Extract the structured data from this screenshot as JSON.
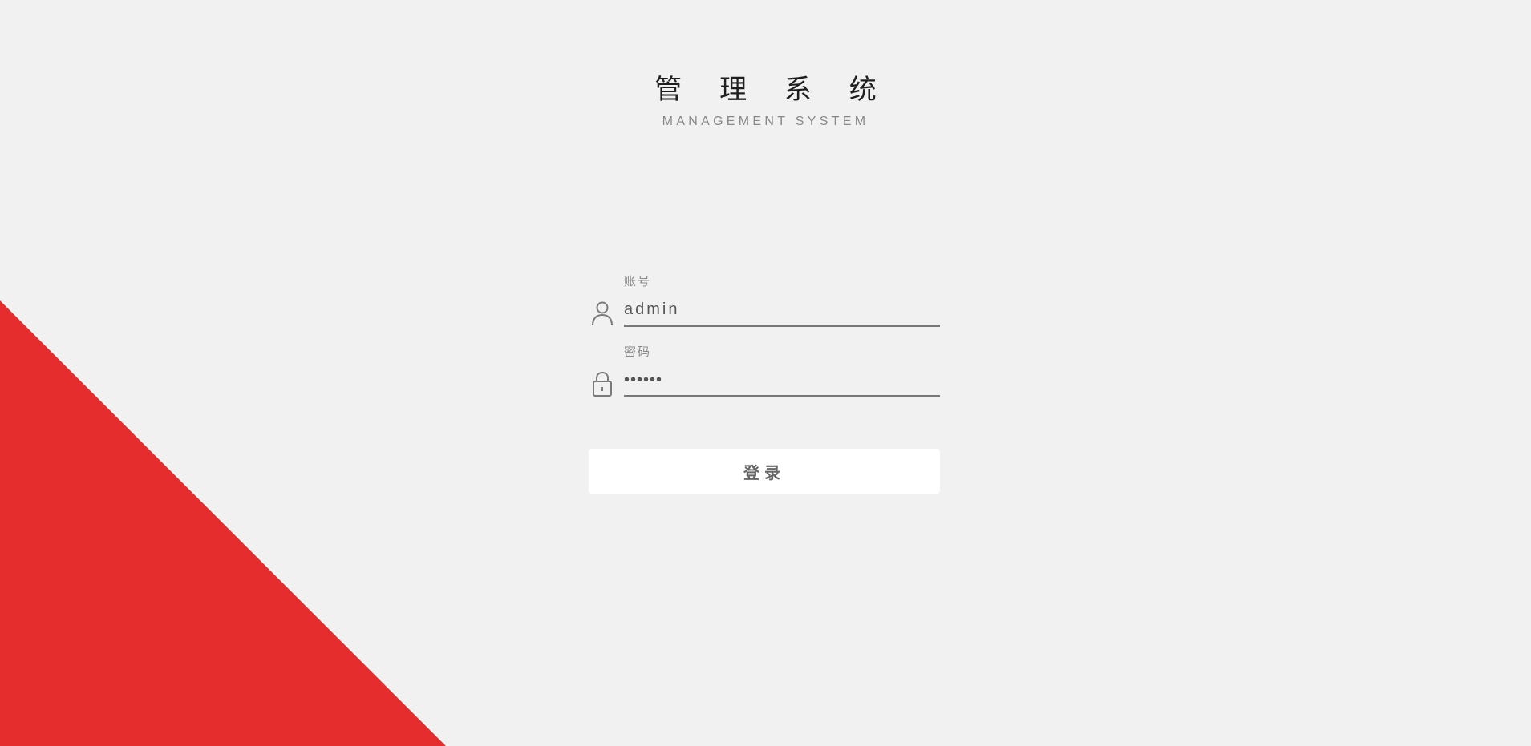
{
  "header": {
    "title_cn": "管 理 系 统",
    "title_en": "MANAGEMENT SYSTEM"
  },
  "login_form": {
    "account": {
      "label": "账号",
      "value": "admin",
      "icon": "user-icon"
    },
    "password": {
      "label": "密码",
      "value": "••••••",
      "icon": "lock-icon"
    },
    "submit_label": "登录"
  },
  "colors": {
    "background": "#f1f1f1",
    "accent_triangle": "#e52d2e",
    "underline": "#777777",
    "button_bg": "#ffffff"
  }
}
